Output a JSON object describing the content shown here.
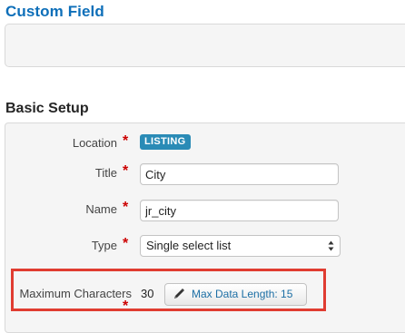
{
  "header": {
    "title": "Custom Field"
  },
  "basic_setup": {
    "title": "Basic Setup",
    "location": {
      "label": "Location",
      "badge": "LISTING"
    },
    "title_field": {
      "label": "Title",
      "value": "City"
    },
    "name_field": {
      "label": "Name",
      "value": "jr_city"
    },
    "type_field": {
      "label": "Type",
      "selected": "Single select list"
    },
    "max_chars": {
      "label": "Maximum Characters",
      "value": "30",
      "button_label": "Max Data Length: 15",
      "button_icon": "pencil-icon"
    },
    "required_marker": "*"
  },
  "colors": {
    "heading_blue": "#0e6fb9",
    "badge_blue": "#2a8bb6",
    "required_red": "#cc0000",
    "highlight_red": "#e03c31"
  }
}
